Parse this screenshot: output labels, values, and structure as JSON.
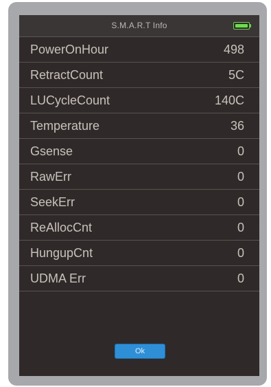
{
  "header": {
    "title": "S.M.A.R.T Info",
    "battery": {
      "level": 1.0,
      "color": "#6dde4f"
    }
  },
  "rows": [
    {
      "label": "PowerOnHour",
      "value": "498"
    },
    {
      "label": "RetractCount",
      "value": "5C"
    },
    {
      "label": "LUCycleCount",
      "value": "140C"
    },
    {
      "label": "Temperature",
      "value": "36"
    },
    {
      "label": "Gsense",
      "value": "0"
    },
    {
      "label": "RawErr",
      "value": "0"
    },
    {
      "label": "SeekErr",
      "value": "0"
    },
    {
      "label": "ReAllocCnt",
      "value": "0"
    },
    {
      "label": "HungupCnt",
      "value": "0"
    },
    {
      "label": "UDMA Err",
      "value": "0"
    }
  ],
  "footer": {
    "ok_label": "Ok",
    "ok_color": "#2f8fd6"
  },
  "colors": {
    "screen_bg": "#2f2a29",
    "text": "#c9c0bb",
    "device_frame": "#a7a8ab"
  }
}
